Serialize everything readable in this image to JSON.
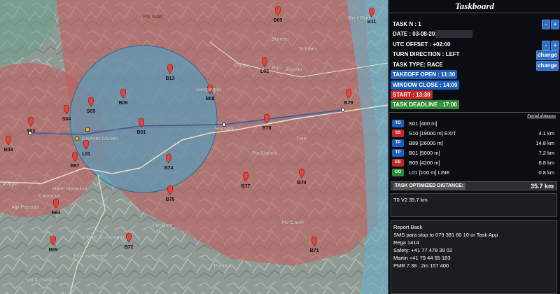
{
  "map": {
    "waypoints": [
      "B09",
      "B11",
      "B13",
      "B06",
      "B08",
      "L02",
      "B79",
      "S05",
      "S04",
      "S03",
      "B01",
      "B78",
      "L01",
      "B03",
      "B67",
      "B74",
      "B77",
      "B70",
      "B75",
      "B64",
      "B65",
      "B72",
      "B71"
    ],
    "places": [
      "Piz Avat",
      "Piz Vial",
      "Piz Nadels",
      "Piz Miez",
      "Piz Cavel",
      "Val Cristallina",
      "Hotel Medelina",
      "Alp Pazzola",
      "Medel (Lucmagn)",
      "Breil Brig",
      "Disentis Mustér",
      "Curaglia",
      "Cavorgia",
      "Fuorns Medel",
      "Lumpegna",
      "Sumvitg",
      "Run",
      "Schlans",
      "Trun",
      "Zignau",
      "Surrein",
      "Glogn"
    ],
    "route_color": "#4a5a8a",
    "zone_blue": "#4aa3c9",
    "zone_red": "#c65a5a"
  },
  "panel": {
    "title": "Taskboard",
    "task_n": "TASK N : 1",
    "date_label": "DATE : 03-08-2025",
    "utc_label": "UTC OFFSET : +02:00",
    "turn_label": "TURN DIRECTION : LEFT",
    "type_label": "TASK TYPE: RACE",
    "takeoff": "TAKEOFF OPEN : 11:30",
    "window": "WINDOW CLOSE : 14:00",
    "start": "START : 13:30",
    "deadline": "TASK DEADLINE : 17:00",
    "minus": "-",
    "plus": "+",
    "change": "change",
    "partial": "Partial distances",
    "turnpoints": [
      {
        "type": "TO",
        "name": "S01 [400 m]",
        "dist": "",
        "color": "#1e5fb8"
      },
      {
        "type": "SS",
        "name": "S10 [19000 m] EXIT",
        "dist": "4.1 km",
        "color": "#c0282c"
      },
      {
        "type": "TP",
        "name": "B89 [26000 m]",
        "dist": "14.8 km",
        "color": "#1e5fb8"
      },
      {
        "type": "TP",
        "name": "B01 [5000 m]",
        "dist": "7.2 km",
        "color": "#1e5fb8"
      },
      {
        "type": "ES",
        "name": "B05 [4200 m]",
        "dist": "8.8 km",
        "color": "#c0282c"
      },
      {
        "type": "GO",
        "name": "L01 [100 m] LINE",
        "dist": "0.8 km",
        "color": "#2e8b34"
      }
    ],
    "optimized_label": "TASK OPTIMIZED DISTANCE:",
    "optimized_value": "35.7 km",
    "summary": "T0 V2 35.7 km",
    "report": [
      "Report Back",
      "SMS  para stop  to  079 381 60 10  or Task App",
      "Rega 1414",
      "Safety: +41 77 478 39 02",
      "Martin +41 79 44 55 183",
      "PMR 7.38 , 2m 157 400"
    ]
  }
}
